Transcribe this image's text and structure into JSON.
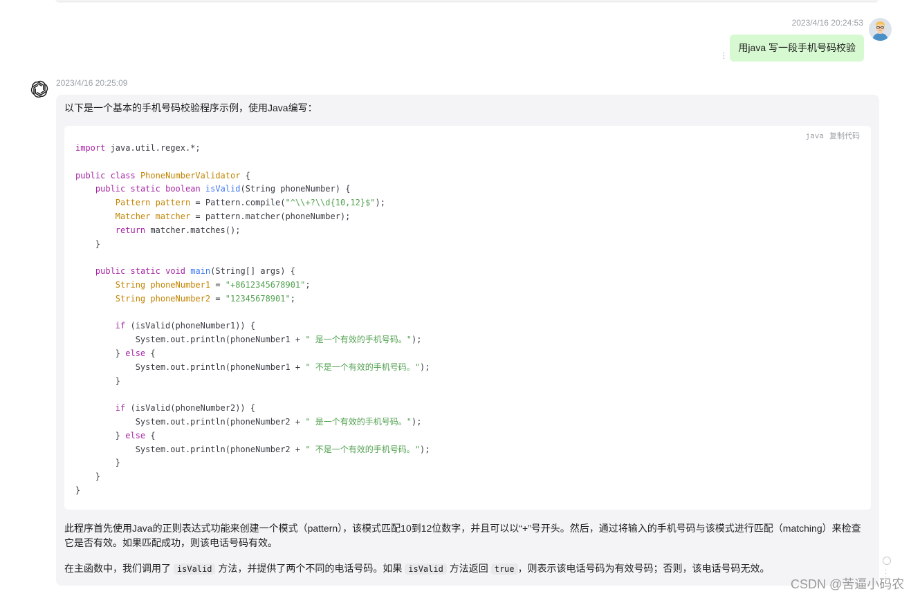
{
  "user_message": {
    "timestamp": "2023/4/16 20:24:53",
    "text": "用java 写一段手机号码校验",
    "more_icon": "⋮"
  },
  "assistant_message": {
    "timestamp": "2023/4/16 20:25:09",
    "intro": "以下是一个基本的手机号码校验程序示例，使用Java编写：",
    "code_block": {
      "language": "java",
      "copy_label": "复制代码"
    },
    "para1": "此程序首先使用Java的正则表达式功能来创建一个模式（pattern），该模式匹配10到12位数字，并且可以以“+”号开头。然后，通过将输入的手机号码与该模式进行匹配（matching）来检查它是否有效。如果匹配成功，则该电话号码有效。",
    "para2": {
      "t1": "在主函数中，我们调用了",
      "c1": "isValid",
      "t2": "方法，并提供了两个不同的电话号码。如果",
      "c2": "isValid",
      "t3": "方法返回",
      "c3": "true",
      "t4": "，则表示该电话号码为有效号码；否则，该电话号码无效。"
    }
  },
  "watermark": "CSDN @苦逼小码农",
  "icons": {
    "user_avatar": "avatar-icon",
    "assistant_avatar": "openai-logo-icon"
  },
  "colors": {
    "user_bubble": "#d7f9d1",
    "assistant_card": "#f4f4f6"
  }
}
